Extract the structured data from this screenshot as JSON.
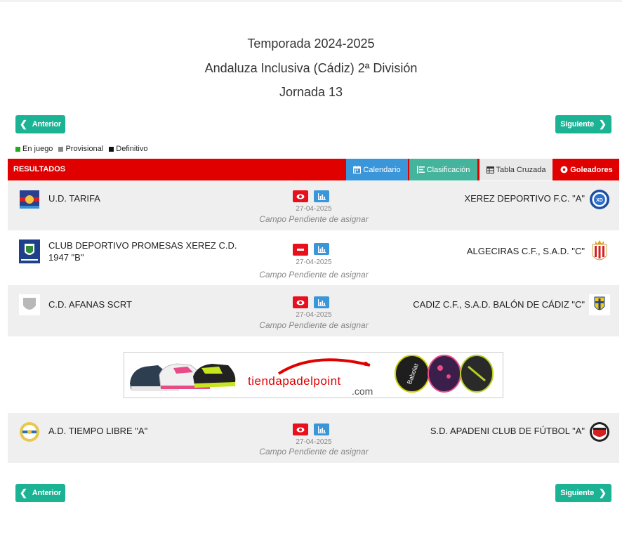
{
  "header": {
    "season": "Temporada 2024-2025",
    "competition": "Andaluza Inclusiva (Cádiz) 2ª División",
    "round": "Jornada 13"
  },
  "nav": {
    "prev_label": "Anterior",
    "next_label": "Siguiente"
  },
  "legend": [
    {
      "label": "En juego",
      "color": "#1faa1f"
    },
    {
      "label": "Provisional",
      "color": "#888888"
    },
    {
      "label": "Definitivo",
      "color": "#111111"
    }
  ],
  "results_bar": {
    "title": "RESULTADOS",
    "tabs": [
      {
        "label": "Calendario",
        "icon": "calendar-icon",
        "bg": "#3b95d9"
      },
      {
        "label": "Clasificación",
        "icon": "list-icon",
        "bg": "#45b49c"
      },
      {
        "label": "Tabla Cruzada",
        "icon": "table-icon",
        "bg": "#e9e9e9"
      },
      {
        "label": "Goleadores",
        "icon": "soccer-ball-icon",
        "bg": "#e00000"
      }
    ]
  },
  "matches": [
    {
      "home": "U.D. TARIFA",
      "away": "XEREZ DEPORTIVO F.C. \"A\"",
      "date": "27-04-2025",
      "venue": "Campo Pendiente de asignar",
      "status_icon": "eye-icon"
    },
    {
      "home": "CLUB DEPORTIVO PROMESAS XEREZ C.D. 1947 \"B\"",
      "away": "ALGECIRAS C.F., S.A.D. \"C\"",
      "date": "27-04-2025",
      "venue": "Campo Pendiente de asignar",
      "status_icon": "minus-icon"
    },
    {
      "home": "C.D. AFANAS SCRT",
      "away": "CADIZ C.F., S.A.D. BALÓN DE CÁDIZ \"C\"",
      "date": "27-04-2025",
      "venue": "Campo Pendiente de asignar",
      "status_icon": "eye-icon"
    },
    {
      "home": "A.D. TIEMPO LIBRE \"A\"",
      "away": "S.D. APADENI CLUB DE FÚTBOL \"A\"",
      "date": "27-04-2025",
      "venue": "Campo Pendiente de asignar",
      "status_icon": "eye-icon"
    }
  ],
  "ad": {
    "brand": "tiendapadelpoint",
    "suffix": ".com",
    "racket_brand": "Babolat"
  },
  "colors": {
    "accent_green": "#1bb394",
    "bar_red": "#e00000",
    "icon_red": "#e8101c",
    "icon_blue": "#3b95d9"
  }
}
